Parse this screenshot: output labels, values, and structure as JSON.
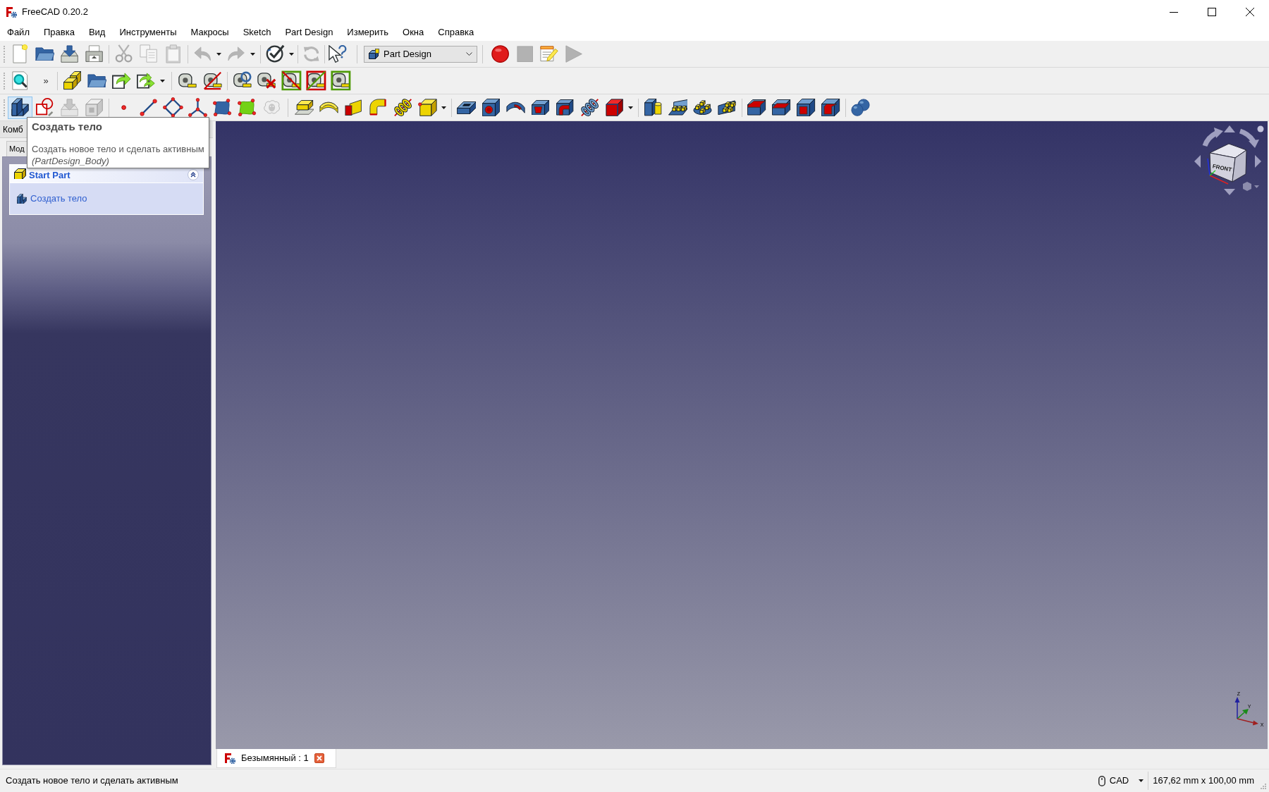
{
  "window": {
    "title": "FreeCAD 0.20.2"
  },
  "menu": [
    "Файл",
    "Правка",
    "Вид",
    "Инструменты",
    "Макросы",
    "Sketch",
    "Part Design",
    "Измерить",
    "Окна",
    "Справка"
  ],
  "toolbars": [
    {
      "workbench": "Part Design",
      "buttons": [
        {
          "disabled": false,
          "hovered": false
        },
        {
          "disabled": false,
          "hovered": false
        },
        {
          "disabled": false,
          "hovered": false
        },
        {
          "disabled": false,
          "hovered": false
        },
        {
          "disabled": true,
          "hovered": false
        },
        {
          "disabled": true,
          "hovered": false
        },
        {
          "disabled": true,
          "hovered": false
        },
        {
          "disabled": true,
          "hovered": false
        },
        {
          "disabled": true,
          "hovered": false
        },
        {
          "disabled": false,
          "hovered": false
        },
        {
          "disabled": true,
          "hovered": false
        },
        {
          "disabled": false,
          "hovered": false
        },
        {
          "disabled": false,
          "hovered": false
        },
        {
          "disabled": true,
          "hovered": false
        },
        {
          "disabled": false,
          "hovered": false
        },
        {
          "disabled": true,
          "hovered": false
        }
      ]
    },
    {
      "overflow": "»",
      "buttons": [
        {
          "disabled": false,
          "hovered": false
        },
        {
          "disabled": false,
          "hovered": false
        },
        {
          "disabled": false,
          "hovered": false
        },
        {
          "disabled": false,
          "hovered": false
        },
        {
          "disabled": false,
          "hovered": false
        },
        {
          "disabled": false,
          "hovered": false
        },
        {
          "disabled": false,
          "hovered": false
        },
        {
          "disabled": false,
          "hovered": false
        },
        {
          "disabled": false,
          "hovered": false
        },
        {
          "disabled": false,
          "hovered": false
        },
        {
          "disabled": false,
          "hovered": false
        },
        {
          "disabled": false,
          "hovered": false
        }
      ]
    },
    {
      "buttons": [
        {
          "disabled": false,
          "hovered": true
        },
        {
          "disabled": false,
          "hovered": false
        },
        {
          "disabled": true,
          "hovered": false
        },
        {
          "disabled": true,
          "hovered": false
        },
        {
          "disabled": false,
          "hovered": false
        },
        {
          "disabled": false,
          "hovered": false
        },
        {
          "disabled": false,
          "hovered": false
        },
        {
          "disabled": false,
          "hovered": false
        },
        {
          "disabled": false,
          "hovered": false
        },
        {
          "disabled": false,
          "hovered": false
        },
        {
          "disabled": true,
          "hovered": false
        },
        {
          "disabled": false,
          "hovered": false
        },
        {
          "disabled": false,
          "hovered": false
        },
        {
          "disabled": false,
          "hovered": false
        },
        {
          "disabled": false,
          "hovered": false
        },
        {
          "disabled": false,
          "hovered": false
        },
        {
          "disabled": false,
          "hovered": false
        },
        {
          "disabled": false,
          "hovered": false
        },
        {
          "disabled": false,
          "hovered": false
        },
        {
          "disabled": false,
          "hovered": false
        },
        {
          "disabled": false,
          "hovered": false
        },
        {
          "disabled": false,
          "hovered": false
        },
        {
          "disabled": false,
          "hovered": false
        },
        {
          "disabled": false,
          "hovered": false
        },
        {
          "disabled": false,
          "hovered": false
        },
        {
          "disabled": false,
          "hovered": false
        },
        {
          "disabled": false,
          "hovered": false
        },
        {
          "disabled": false,
          "hovered": false
        },
        {
          "disabled": false,
          "hovered": false
        },
        {
          "disabled": false,
          "hovered": false
        },
        {
          "disabled": false,
          "hovered": false
        },
        {
          "disabled": false,
          "hovered": false
        },
        {
          "disabled": false,
          "hovered": false
        }
      ]
    }
  ],
  "combo_view": {
    "title": "Комб",
    "tabs": [
      {
        "label": "Мод",
        "selected": false
      }
    ],
    "task_panel": {
      "title": "Start Part",
      "expanded": true,
      "items": [
        {
          "label": "Создать тело"
        }
      ]
    }
  },
  "tooltip": {
    "title": "Создать тело",
    "description": "Создать новое тело и сделать активным",
    "command": "(PartDesign_Body)"
  },
  "view_3d": {
    "navigation_cube": {
      "front_label": "FRONT"
    },
    "axis_cross": {
      "x_label": "X",
      "y_label": "Y",
      "z_label": "Z"
    }
  },
  "document_tabs": [
    {
      "label": "Безымянный : 1",
      "selected": true
    }
  ],
  "status_bar": {
    "message": "Создать новое тело и сделать активным",
    "navigation_style": "CAD",
    "dimensions": "167,62 mm x 100,00 mm"
  }
}
